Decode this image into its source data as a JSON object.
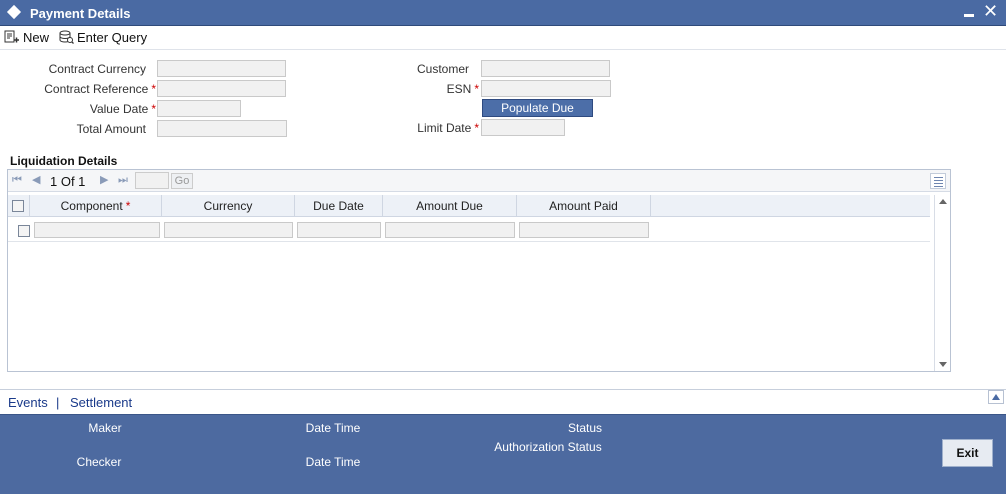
{
  "window": {
    "title": "Payment Details"
  },
  "toolbar": {
    "new_label": "New",
    "enter_query_label": "Enter Query"
  },
  "form": {
    "contract_currency": {
      "label": "Contract Currency",
      "value": ""
    },
    "contract_reference": {
      "label": "Contract Reference",
      "required": "*",
      "value": ""
    },
    "value_date": {
      "label": "Value Date",
      "required": "*",
      "value": ""
    },
    "total_amount": {
      "label": "Total Amount",
      "value": ""
    },
    "customer": {
      "label": "Customer",
      "value": ""
    },
    "esn": {
      "label": "ESN",
      "required": "*",
      "value": ""
    },
    "populate_due_label": "Populate Due",
    "limit_date": {
      "label": "Limit Date",
      "required": "*",
      "value": ""
    }
  },
  "liquidation": {
    "section_title": "Liquidation Details",
    "pager": {
      "page_text": "1 Of 1",
      "go_label": "Go"
    },
    "columns": [
      {
        "label": "Component",
        "required": "*"
      },
      {
        "label": "Currency"
      },
      {
        "label": "Due Date"
      },
      {
        "label": "Amount Due"
      },
      {
        "label": "Amount Paid"
      }
    ],
    "rows": [
      {
        "component": "",
        "currency": "",
        "due_date": "",
        "amount_due": "",
        "amount_paid": ""
      }
    ]
  },
  "tabs": {
    "events": "Events",
    "separator": "|",
    "settlement": "Settlement"
  },
  "footer": {
    "maker": "Maker",
    "maker_date_time": "Date Time",
    "checker": "Checker",
    "checker_date_time": "Date Time",
    "status": "Status",
    "authorization_status": "Authorization Status",
    "exit_label": "Exit"
  },
  "colors": {
    "title_bar": "#4a6aa3",
    "footer": "#4d6aa0",
    "required": "#cc0000",
    "link": "#1a3a8a"
  }
}
